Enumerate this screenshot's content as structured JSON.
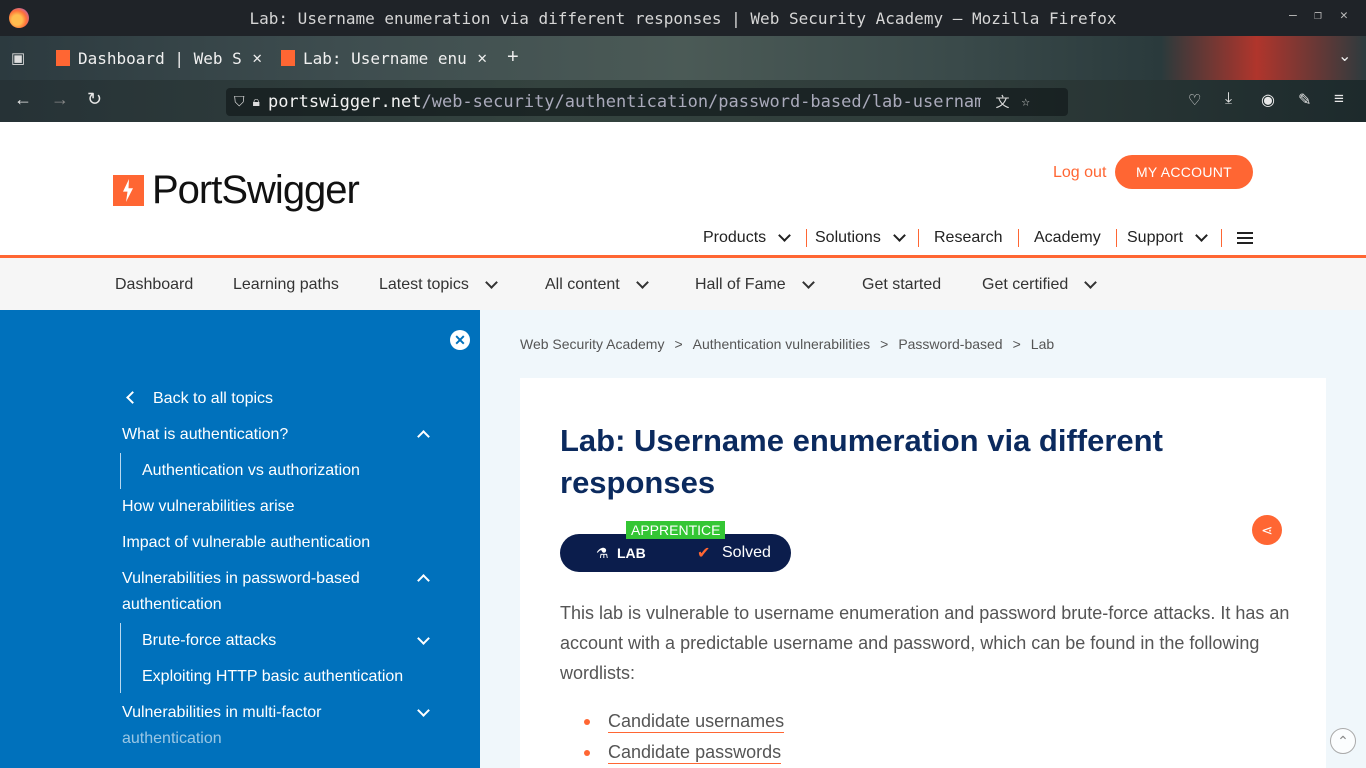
{
  "browser": {
    "window_title": "Lab: Username enumeration via different responses | Web Security Academy — Mozilla Firefox",
    "tabs": [
      {
        "label": "Dashboard | Web S"
      },
      {
        "label": "Lab: Username enu"
      }
    ],
    "url": {
      "host": "portswigger.net",
      "path": "/web-security/authentication/password-based/lab-username"
    }
  },
  "header": {
    "logo_text": "PortSwigger",
    "logout": "Log out",
    "my_account": "MY ACCOUNT",
    "nav": [
      "Products",
      "Solutions",
      "Research",
      "Academy",
      "Support"
    ]
  },
  "subnav": [
    "Dashboard",
    "Learning paths",
    "Latest topics",
    "All content",
    "Hall of Fame",
    "Get started",
    "Get certified"
  ],
  "sidebar": {
    "back": "Back to all topics",
    "items": [
      "What is authentication?",
      "Authentication vs authorization",
      "How vulnerabilities arise",
      "Impact of vulnerable authentication",
      "Vulnerabilities in password-based",
      "authentication",
      "Brute-force attacks",
      "Exploiting HTTP basic authentication",
      "Vulnerabilities in multi-factor",
      "authentication"
    ]
  },
  "breadcrumbs": [
    "Web Security Academy",
    "Authentication vulnerabilities",
    "Password-based",
    "Lab"
  ],
  "lab": {
    "title": "Lab: Username enumeration via different responses",
    "level": "APPRENTICE",
    "badge_label": "LAB",
    "status": "Solved",
    "description": "This lab is vulnerable to username enumeration and password brute-force attacks. It has an account with a predictable username and password, which can be found in the following wordlists:",
    "links": [
      "Candidate usernames",
      "Candidate passwords"
    ]
  },
  "colors": {
    "accent": "#ff6633",
    "sidebar": "#0071bc",
    "title": "#0b2a5e",
    "badge": "#0b1d4c",
    "apprentice": "#34c634"
  }
}
